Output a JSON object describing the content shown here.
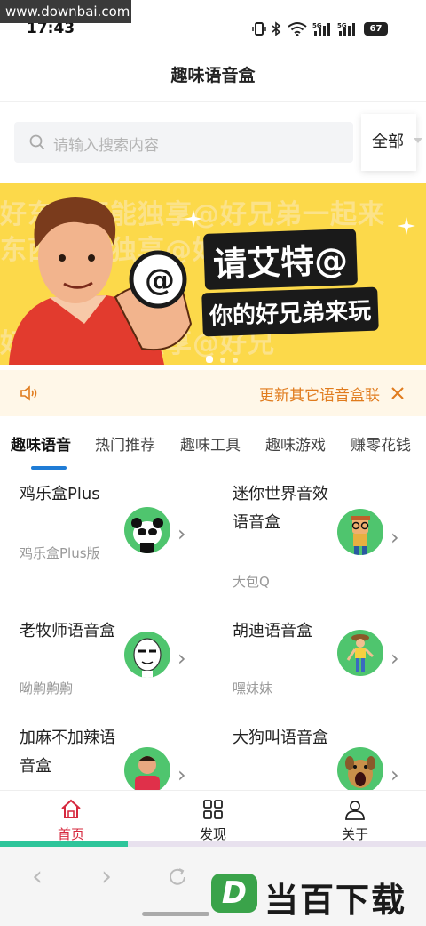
{
  "watermark": "www.downbai.com",
  "status_bar": {
    "time": "17:43",
    "battery": "67"
  },
  "header": {
    "title": "趣味语音盒"
  },
  "search": {
    "placeholder": "请输入搜索内容",
    "filter": "全部"
  },
  "banner": {
    "line1": "请艾特@",
    "line2": "你的好兄弟来玩",
    "bg_text": [
      "好东西不能独享@好兄弟一起来",
      "东西不能独享@好兄弟一起",
      "好东西不能独享@好兄"
    ]
  },
  "notice": {
    "text": "更新其它语音盒联"
  },
  "tabs": [
    "趣味语音",
    "热门推荐",
    "趣味工具",
    "趣味游戏",
    "赚零花钱"
  ],
  "items": [
    {
      "title": "鸡乐盒Plus",
      "sub": "鸡乐盒Plus版",
      "avatar": "panda"
    },
    {
      "title": "迷你世界音效语音盒",
      "sub": "大包Q",
      "avatar": "cartoon"
    },
    {
      "title": "老牧师语音盒",
      "sub": "呦齁齁齁",
      "avatar": "meme"
    },
    {
      "title": "胡迪语音盒",
      "sub": "嘿妹妹",
      "avatar": "woody"
    },
    {
      "title": "加麻不加辣语音盒",
      "sub": "",
      "avatar": "person"
    },
    {
      "title": "大狗叫语音盒",
      "sub": "",
      "avatar": "dog"
    }
  ],
  "bottom_nav": [
    {
      "label": "首页"
    },
    {
      "label": "发现"
    },
    {
      "label": "关于"
    }
  ],
  "progress_percent": 30,
  "brand": {
    "logo_letter": "D",
    "logo_text": "当百下载"
  },
  "colors": {
    "accent": "#d6283e",
    "tab_indicator": "#1f7cd6",
    "notice_text": "#e07b1d",
    "avatar_bg": "#4fc56e"
  }
}
